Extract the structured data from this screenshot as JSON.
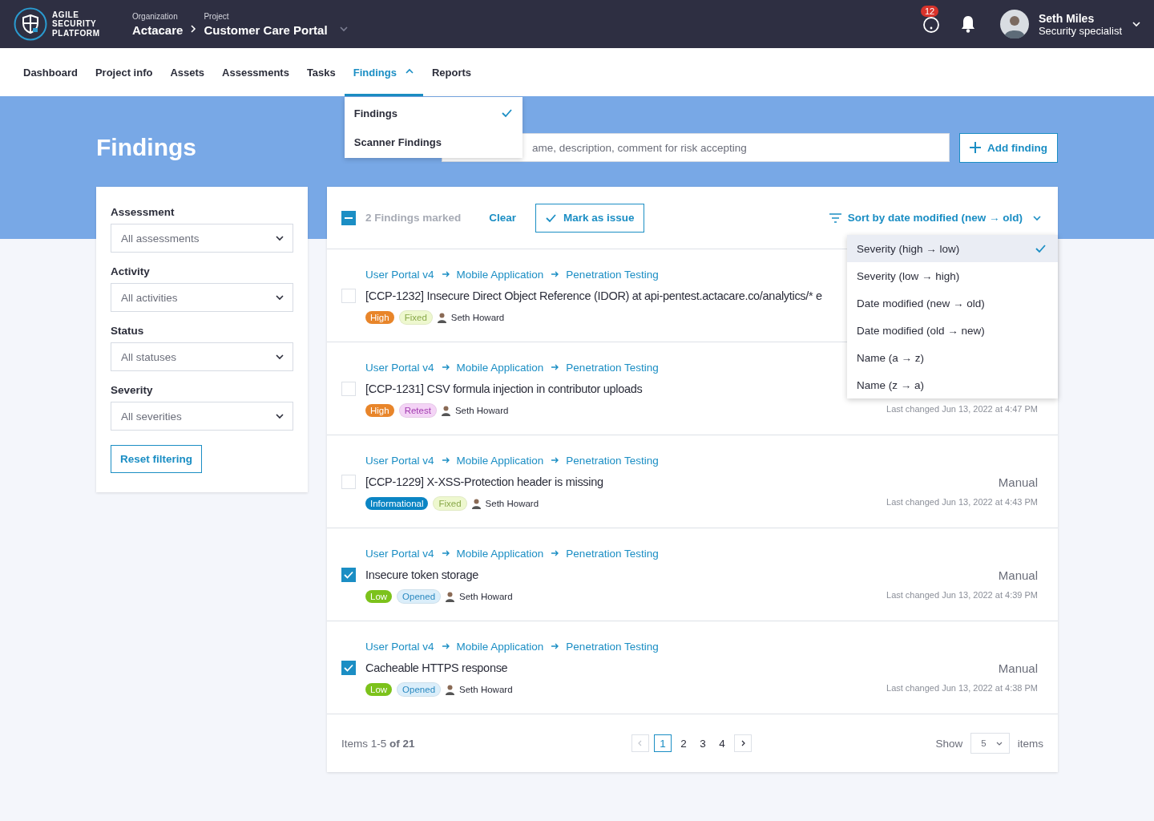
{
  "brand": {
    "lines": [
      "AGILE",
      "SECURITY",
      "PLATFORM"
    ]
  },
  "breadcrumb": [
    {
      "label": "Organization",
      "value": "Actacare"
    },
    {
      "label": "Project",
      "value": "Customer Care Portal"
    }
  ],
  "notifications": {
    "count": "12"
  },
  "user": {
    "name": "Seth Miles",
    "role": "Security specialist"
  },
  "nav": [
    {
      "label": "Dashboard",
      "selected": false
    },
    {
      "label": "Project info",
      "selected": false
    },
    {
      "label": "Assets",
      "selected": false
    },
    {
      "label": "Assessments",
      "selected": false
    },
    {
      "label": "Tasks",
      "selected": false
    },
    {
      "label": "Findings",
      "selected": true,
      "expanded": true,
      "menu": [
        {
          "label": "Findings",
          "selected": true
        },
        {
          "label": "Scanner Findings",
          "selected": false
        }
      ]
    },
    {
      "label": "Reports",
      "selected": false
    }
  ],
  "page_title": "Findings",
  "search": {
    "placeholder": "ame, description, comment for risk accepting"
  },
  "add_button": "Add finding",
  "filters": [
    {
      "label": "Assessment",
      "value": "All assessments"
    },
    {
      "label": "Activity",
      "value": "All activities"
    },
    {
      "label": "Status",
      "value": "All statuses"
    },
    {
      "label": "Severity",
      "value": "All severities"
    }
  ],
  "reset_button": "Reset filtering",
  "toolbar": {
    "select_all": {
      "indeterminate": true
    },
    "marked": "2 Findings marked",
    "clear": "Clear",
    "mark_issue": "Mark as issue",
    "sort": {
      "label": "Sort by date modified (new → old)",
      "expanded": true,
      "options": [
        {
          "label": "Severity (high → low)",
          "selected": true
        },
        {
          "label": "Severity (low → high)",
          "selected": false
        },
        {
          "label": "Date modified (new → old)",
          "selected": false
        },
        {
          "label": "Date modified (old → new)",
          "selected": false
        },
        {
          "label": "Name (a → z)",
          "selected": false
        },
        {
          "label": "Name (z → a)",
          "selected": false
        }
      ]
    }
  },
  "findings": [
    {
      "path": [
        "User Portal v4",
        "Mobile Application",
        "Penetration Testing"
      ],
      "checked": false,
      "title": "[CCP-1232] Insecure Direct Object Reference (IDOR) at api-pentest.actacare.co/analytics/* e",
      "severity": {
        "label": "High",
        "kind": "high"
      },
      "status": {
        "label": "Fixed",
        "kind": "fixed"
      },
      "assignee": "Seth Howard"
    },
    {
      "path": [
        "User Portal v4",
        "Mobile Application",
        "Penetration Testing"
      ],
      "checked": false,
      "title": "[CCP-1231] CSV formula injection in contributor uploads",
      "severity": {
        "label": "High",
        "kind": "high"
      },
      "status": {
        "label": "Retest",
        "kind": "retest"
      },
      "assignee": "Seth Howard",
      "changed": "Last changed Jun 13, 2022 at 4:47 PM"
    },
    {
      "path": [
        "User Portal v4",
        "Mobile Application",
        "Penetration Testing"
      ],
      "checked": false,
      "title": "[CCP-1229] X-XSS-Protection header is missing",
      "severity": {
        "label": "Informational",
        "kind": "informational"
      },
      "status": {
        "label": "Fixed",
        "kind": "fixed"
      },
      "assignee": "Seth Howard",
      "type": "Manual",
      "changed": "Last changed Jun 13, 2022 at 4:43 PM"
    },
    {
      "path": [
        "User Portal v4",
        "Mobile Application",
        "Penetration Testing"
      ],
      "checked": true,
      "title": "Insecure token storage",
      "severity": {
        "label": "Low",
        "kind": "low"
      },
      "status": {
        "label": "Opened",
        "kind": "opened"
      },
      "assignee": "Seth Howard",
      "type": "Manual",
      "changed": "Last changed Jun 13, 2022 at 4:39 PM"
    },
    {
      "path": [
        "User Portal v4",
        "Mobile Application",
        "Penetration Testing"
      ],
      "checked": true,
      "title": "Cacheable HTTPS response",
      "severity": {
        "label": "Low",
        "kind": "low"
      },
      "status": {
        "label": "Opened",
        "kind": "opened"
      },
      "assignee": "Seth Howard",
      "type": "Manual",
      "changed": "Last changed Jun 13, 2022 at 4:38 PM"
    }
  ],
  "pagination": {
    "summary": "Items 1-5 **of 21**",
    "pages": [
      {
        "label": "1",
        "selected": true
      },
      {
        "label": "2",
        "selected": false
      },
      {
        "label": "3",
        "selected": false
      },
      {
        "label": "4",
        "selected": false
      }
    ],
    "show_label": "Show",
    "page_size": "5",
    "items_label": "items"
  }
}
